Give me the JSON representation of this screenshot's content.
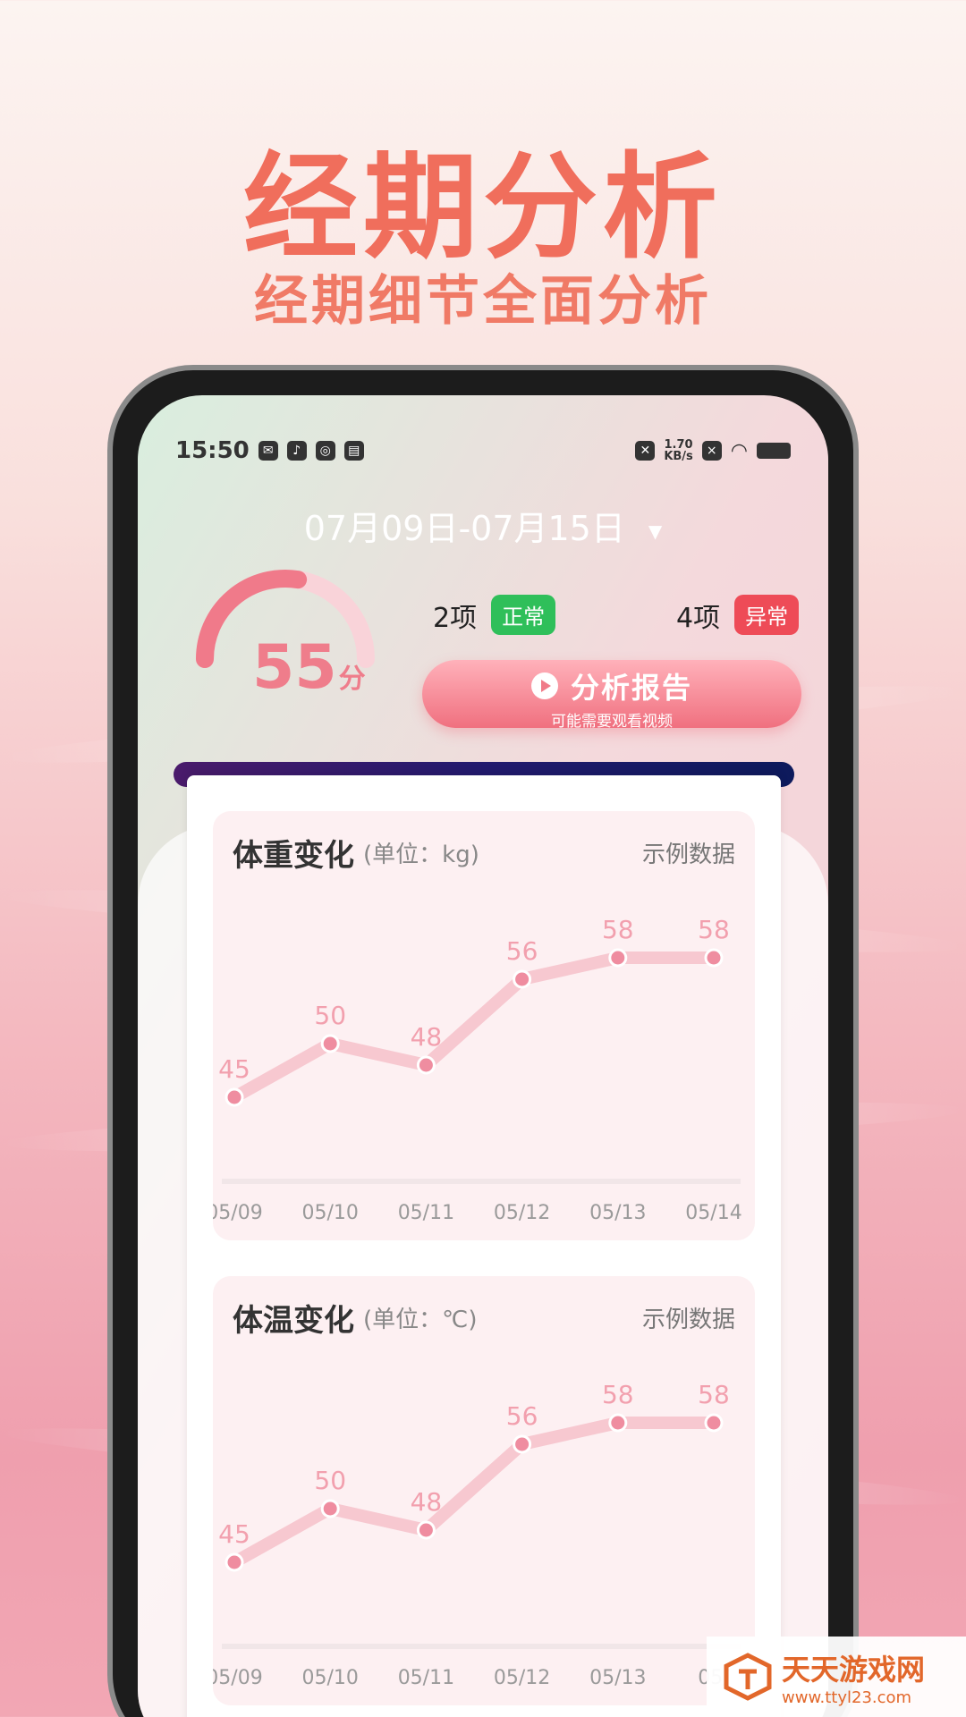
{
  "promo": {
    "title": "经期分析",
    "subtitle": "经期细节全面分析"
  },
  "statusbar": {
    "time": "15:50",
    "net_speed": "1.70",
    "net_unit": "KB/s"
  },
  "header": {
    "date_range": "07月09日-07月15日"
  },
  "score": {
    "value": "55",
    "unit": "分",
    "fraction": 0.55
  },
  "stats": {
    "normal": {
      "count": "2项",
      "label": "正常",
      "color": "#2fbf5a"
    },
    "abnormal": {
      "count": "4项",
      "label": "异常",
      "color": "#ee4b57"
    }
  },
  "report_button": {
    "label": "分析报告",
    "sublabel": "可能需要观看视频"
  },
  "cards": [
    {
      "title": "体重变化",
      "unit": "(单位：kg)",
      "sample_label": "示例数据",
      "chart_data": {
        "type": "line",
        "categories": [
          "05/09",
          "05/10",
          "05/11",
          "05/12",
          "05/13",
          "05/14"
        ],
        "values": [
          45,
          50,
          48,
          56,
          58,
          58
        ]
      }
    },
    {
      "title": "体温变化",
      "unit": "(单位：℃)",
      "sample_label": "示例数据",
      "chart_data": {
        "type": "line",
        "categories": [
          "05/09",
          "05/10",
          "05/11",
          "05/12",
          "05/13",
          "05/"
        ],
        "values": [
          45,
          50,
          48,
          56,
          58,
          58
        ]
      }
    }
  ],
  "watermark": {
    "title": "天天游戏网",
    "url": "www.ttyl23.com"
  },
  "colors": {
    "accent": "#f06e5c",
    "line": "#f7c8d0",
    "point": "#ef8da0",
    "label": "#f2a0ae"
  }
}
